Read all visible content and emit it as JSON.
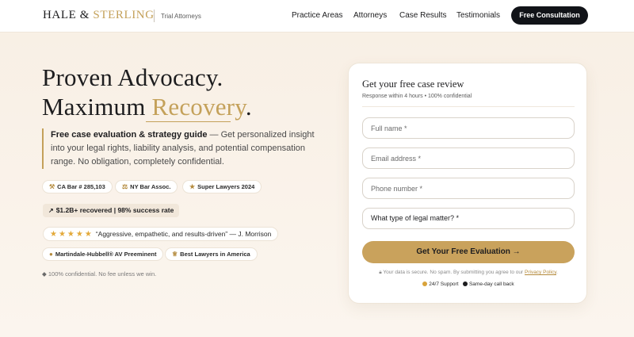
{
  "brand": {
    "name_part1": "HALE &",
    "name_part2": "STERLING",
    "tagline": "Trial Attorneys",
    "accent_color": "#c4a15a"
  },
  "nav": {
    "links": [
      "Practice Areas",
      "Attorneys",
      "Case Results",
      "Testimonials"
    ],
    "cta_label": "Free Consultation"
  },
  "hero": {
    "line1": "Proven Advocacy.",
    "line2_prefix": "Maximum",
    "line2_accent": "Recovery",
    "line2_suffix": ".",
    "lede_bold": "Free case evaluation & strategy guide",
    "lede_text": " — Get personalized insight into your legal rights, liability analysis, and potential compensation range. No obligation, completely confidential.",
    "badges": [
      {
        "label": "CA Bar # 285,103",
        "icon": "gavel-icon"
      },
      {
        "label": "NY Bar Assoc.",
        "icon": "scales-icon"
      },
      {
        "label": "Super Lawyers 2024",
        "icon": "award-icon"
      }
    ],
    "stat": "$1.2B+ recovered | 98% success rate",
    "review": {
      "stars": 5,
      "quote": "“Aggressive, empathetic, and results-driven” — J. Morrison"
    },
    "awards": [
      {
        "label": "Martindale-Hubbell® AV Preeminent",
        "icon": "seal-icon"
      },
      {
        "label": "Best Lawyers in America",
        "icon": "trophy-icon"
      }
    ],
    "note": "100% confidential. No fee unless we win."
  },
  "form": {
    "title": "Get your free case review",
    "subtitle": "Response within 4 hours • 100% confidential",
    "fields": {
      "name_placeholder": "Full name *",
      "email_placeholder": "Email address *",
      "phone_placeholder": "Phone number *"
    },
    "matter_select": "What type of legal matter? *",
    "submit_label": "Get Your Free Evaluation →",
    "secure_text": "Your data is secure. No spam. By submitting you agree to our",
    "privacy_link": "Privacy Policy",
    "support": [
      "24/7 Support",
      "Same-day call back"
    ]
  }
}
